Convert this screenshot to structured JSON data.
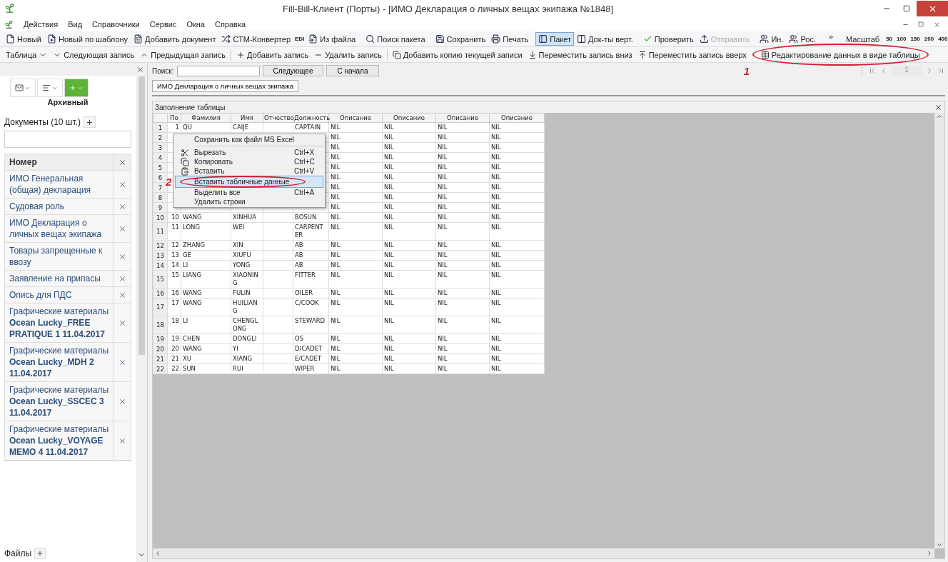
{
  "window": {
    "title": "Fill-Bill-Клиент (Порты) - [ИМО Декларация о личных вещах экипажа №1848]"
  },
  "menu": [
    "Действия",
    "Вид",
    "Справочники",
    "Сервис",
    "Окна",
    "Справка"
  ],
  "toolbar1": {
    "groups": [
      {
        "kind": "plain",
        "items": [
          {
            "label": "Новый",
            "kind": "button"
          },
          {
            "label": "Новый по шаблону",
            "kind": "button"
          },
          {
            "label": "Добавить документ",
            "kind": "button"
          },
          {
            "label": "СТМ-Конвертер",
            "kind": "button"
          },
          {
            "label": "EDI",
            "kind": "tag"
          },
          {
            "label": "Из файла",
            "kind": "button"
          }
        ]
      },
      {
        "kind": "plain",
        "items": [
          {
            "label": "Поиск пакета",
            "kind": "button"
          }
        ]
      },
      {
        "kind": "plain",
        "items": [
          {
            "label": "Сохранить",
            "kind": "button"
          },
          {
            "label": "Печать",
            "kind": "button"
          }
        ]
      },
      {
        "kind": "toggle",
        "items": [
          {
            "label": "Пакет",
            "selected": true
          },
          {
            "label": "Док-ты верт.",
            "selected": false
          }
        ]
      },
      {
        "kind": "state",
        "items": [
          {
            "label": "Проверить",
            "disabled": false
          },
          {
            "label": "Отправить",
            "disabled": true
          }
        ]
      },
      {
        "kind": "plain",
        "items": [
          {
            "label": "Ин.",
            "kind": "button"
          },
          {
            "label": "Рос.",
            "kind": "button"
          }
        ]
      }
    ],
    "overflow": "»",
    "scale_label": "Масштаб",
    "scales": [
      "50",
      "100",
      "150",
      "200",
      "400"
    ]
  },
  "toolbar2": {
    "groups": [
      {
        "items": [
          {
            "label": "Таблица"
          },
          {
            "label": "Следующая запись"
          },
          {
            "label": "Предыдущая запись"
          }
        ]
      },
      {
        "items": [
          {
            "label": "Добавить запись"
          },
          {
            "label": "Удалить запись"
          }
        ]
      },
      {
        "items": [
          {
            "label": "Добавить копию текущей записи"
          },
          {
            "label": "Переместить запись вниз"
          },
          {
            "label": "Переместить запись вверх"
          },
          {
            "label": "Редактирование данных в виде таблицы",
            "annotation": "1"
          }
        ]
      }
    ]
  },
  "sidebar": {
    "status": "Архивный",
    "documents_label": "Документы (10 шт.)",
    "column": "Номер",
    "documents": [
      "ИМО Генеральная (общая) декларация",
      "Судовая роль",
      "ИМО Декларация о личных вещах экипажа",
      "Товары запрещенные к ввозу",
      "Заявление на припасы",
      "Опись для ПДС",
      "Графические материалы **Ocean Lucky_FREE PRATIQUE 1 11.04.2017**",
      "Графические материалы **Ocean Lucky_MDH 2 11.04.2017**",
      "Графические материалы **Ocean Lucky_SSCEC 3 11.04.2017**",
      "Графические материалы **Ocean Lucky_VOYAGE MEMO 4 11.04.2017**"
    ],
    "files_label": "Файлы"
  },
  "search": {
    "label": "Поиск:",
    "buttons": [
      "Следующее",
      "С начала"
    ]
  },
  "pager": {
    "page": "1"
  },
  "tabs": [
    {
      "label": "ИМО Декларация о личных вещах экипажа",
      "selected": true
    }
  ],
  "panel": {
    "title": "Заполнение таблицы"
  },
  "table": {
    "columns": [
      "По",
      "Фамилия",
      "Имя",
      "Отчество",
      "Должность",
      "Описание",
      "Описание",
      "Описание",
      "Описание"
    ],
    "rows": [
      {
        "row": "1",
        "no": "1",
        "surname": "QU",
        "name": "CAIJE",
        "position": "CAPTAIN",
        "desc": [
          "NIL",
          "NIL",
          "NIL",
          "NIL"
        ]
      },
      {
        "row": "2",
        "desc": [
          "NIL",
          "NIL",
          "NIL",
          "NIL"
        ]
      },
      {
        "row": "3",
        "desc": [
          "NIL",
          "NIL",
          "NIL",
          "NIL"
        ]
      },
      {
        "row": "4",
        "desc": [
          "NIL",
          "NIL",
          "NIL",
          "NIL"
        ]
      },
      {
        "row": "5",
        "desc": [
          "NIL",
          "NIL",
          "NIL",
          "NIL"
        ]
      },
      {
        "row": "6",
        "desc": [
          "NIL",
          "NIL",
          "NIL",
          "NIL"
        ]
      },
      {
        "row": "7",
        "desc": [
          "NIL",
          "NIL",
          "NIL",
          "NIL"
        ]
      },
      {
        "row": "8",
        "desc": [
          "NIL",
          "NIL",
          "NIL",
          "NIL"
        ]
      },
      {
        "row": "9",
        "desc": [
          "NIL",
          "NIL",
          "NIL",
          "NIL"
        ]
      },
      {
        "row": "10",
        "no": "10",
        "surname": "WANG",
        "name": "XINHUA",
        "position": "BOSUN",
        "desc": [
          "NIL",
          "NIL",
          "NIL",
          "NIL"
        ]
      },
      {
        "row": "11",
        "no": "11",
        "surname": "LONG",
        "name": "WEI",
        "position": "CARPENTER",
        "desc": [
          "NIL",
          "NIL",
          "NIL",
          "NIL"
        ]
      },
      {
        "row": "12",
        "no": "12",
        "surname": "ZHANG",
        "name": "XIN",
        "position": "AB",
        "desc": [
          "NIL",
          "NIL",
          "NIL",
          "NIL"
        ]
      },
      {
        "row": "13",
        "no": "13",
        "surname": "GE",
        "name": "XIUFU",
        "position": "AB",
        "desc": [
          "NIL",
          "NIL",
          "NIL",
          "NIL"
        ]
      },
      {
        "row": "14",
        "no": "14",
        "surname": "LI",
        "name": "YONG",
        "position": "AB",
        "desc": [
          "NIL",
          "NIL",
          "NIL",
          "NIL"
        ]
      },
      {
        "row": "15",
        "no": "15",
        "surname": "LIANG",
        "name": "XIAONING",
        "position": "FITTER",
        "desc": [
          "NIL",
          "NIL",
          "NIL",
          "NIL"
        ]
      },
      {
        "row": "16",
        "no": "16",
        "surname": "WANG",
        "name": "FULIN",
        "position": "OILER",
        "desc": [
          "NIL",
          "NIL",
          "NIL",
          "NIL"
        ]
      },
      {
        "row": "17",
        "no": "17",
        "surname": "WANG",
        "name": "HUILIANG",
        "position": "C/COOK",
        "desc": [
          "NIL",
          "NIL",
          "NIL",
          "NIL"
        ]
      },
      {
        "row": "18",
        "no": "18",
        "surname": "LI",
        "name": "CHENGLONG",
        "position": "STEWARD",
        "desc": [
          "NIL",
          "NIL",
          "NIL",
          "NIL"
        ]
      },
      {
        "row": "19",
        "no": "19",
        "surname": "CHEN",
        "name": "DONGLI",
        "position": "OS",
        "desc": [
          "NIL",
          "NIL",
          "NIL",
          "NIL"
        ]
      },
      {
        "row": "20",
        "no": "20",
        "surname": "WANG",
        "name": "YI",
        "position": "D/CADET",
        "desc": [
          "NIL",
          "NIL",
          "NIL",
          "NIL"
        ]
      },
      {
        "row": "21",
        "no": "21",
        "surname": "XU",
        "name": "XIANG",
        "position": "E/CADET",
        "desc": [
          "NIL",
          "NIL",
          "NIL",
          "NIL"
        ]
      },
      {
        "row": "22",
        "no": "22",
        "surname": "SUN",
        "name": "RUI",
        "position": "WIPER",
        "desc": [
          "NIL",
          "NIL",
          "NIL",
          "NIL"
        ]
      }
    ]
  },
  "context_menu": {
    "groups": [
      [
        {
          "label": "Сохранить как файл MS Excel",
          "selected": false
        }
      ],
      [
        {
          "label": "Вырезать",
          "shortcut": "Ctrl+X",
          "selected": false
        },
        {
          "label": "Копировать",
          "shortcut": "Ctrl+C",
          "selected": false
        },
        {
          "label": "Вставить",
          "shortcut": "Ctrl+V",
          "selected": false
        },
        {
          "label": "Вставить табличные данные",
          "selected": true,
          "annotation": "2"
        },
        {
          "label": "Выделить все",
          "shortcut": "Ctrl+A",
          "selected": false
        },
        {
          "label": "Удалить строки",
          "selected": false
        }
      ]
    ]
  }
}
